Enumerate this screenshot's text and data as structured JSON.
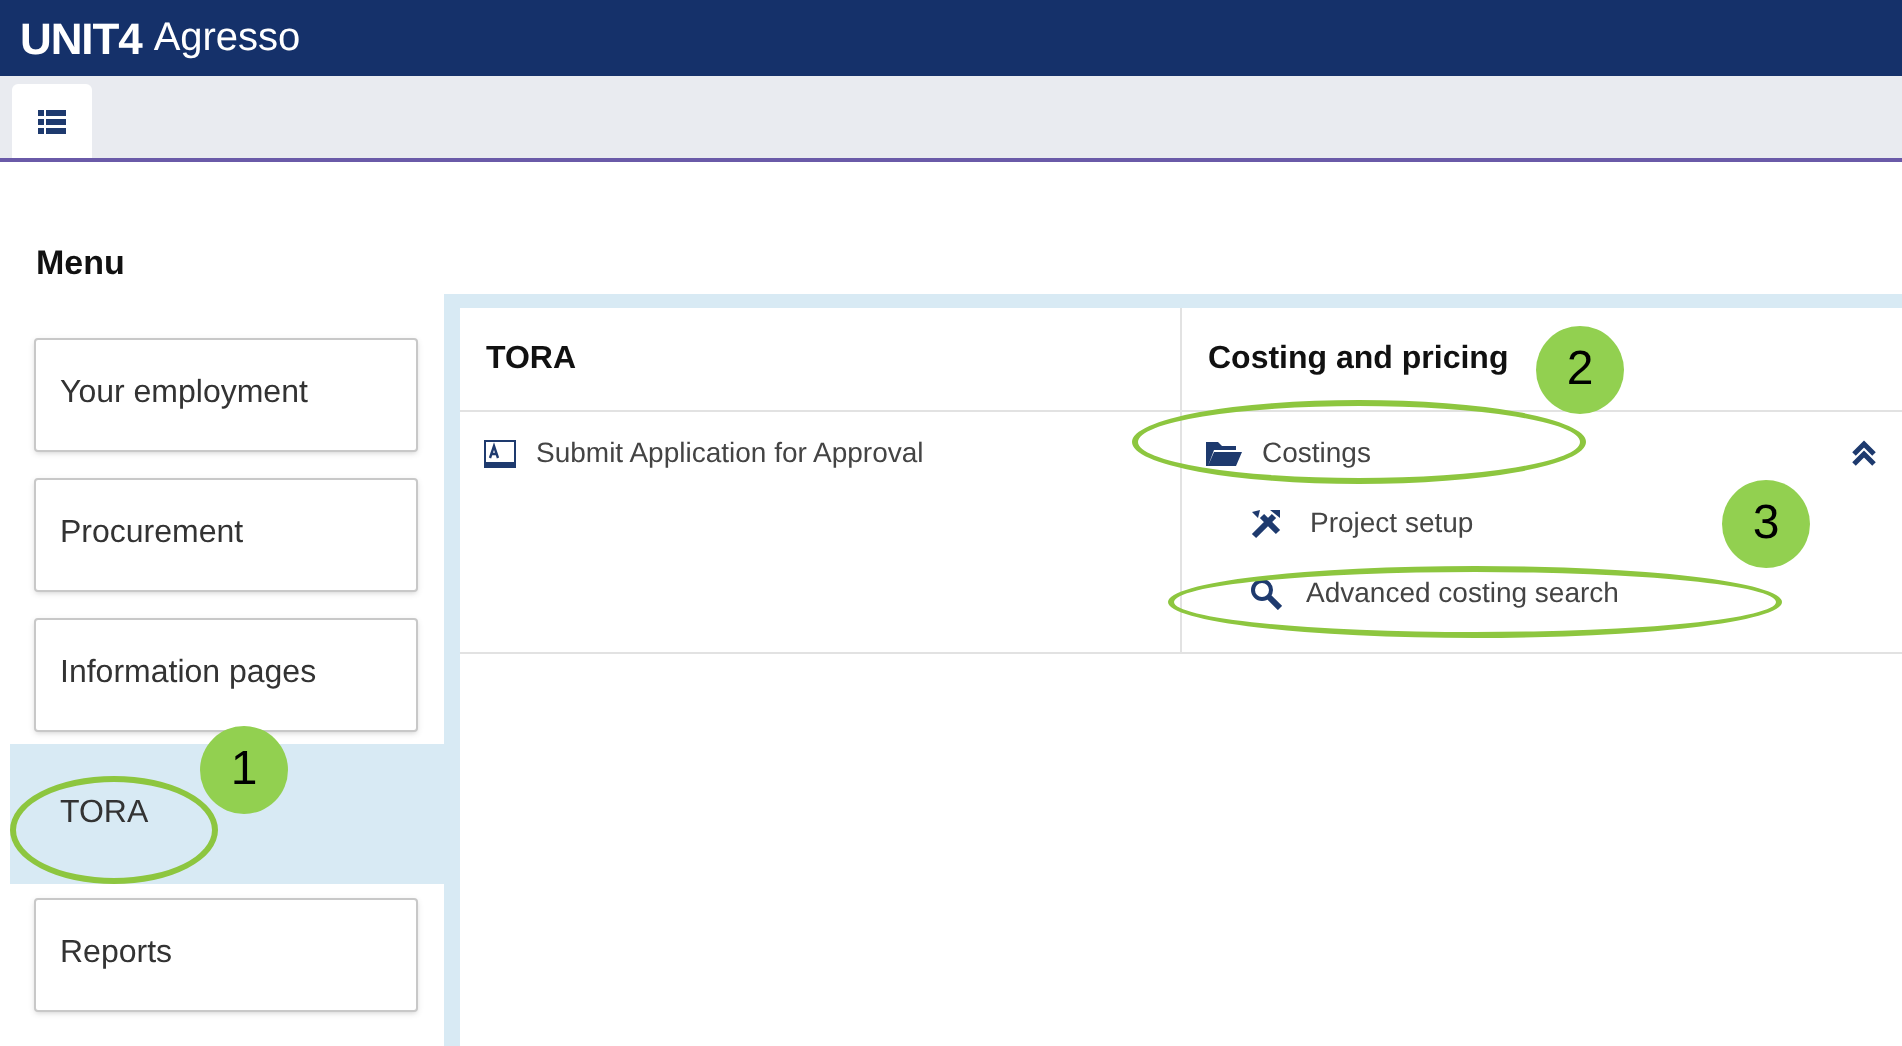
{
  "app": {
    "brand": "UNIT4",
    "product": "Agresso"
  },
  "tabs": [
    {
      "kind": "menu",
      "selected": true
    }
  ],
  "menu": {
    "title": "Menu",
    "items": [
      {
        "label": "Your employment",
        "selected": false
      },
      {
        "label": "Procurement",
        "selected": false
      },
      {
        "label": "Information pages",
        "selected": false
      },
      {
        "label": "TORA",
        "selected": true
      },
      {
        "label": "Reports",
        "selected": false
      }
    ]
  },
  "panel": {
    "columns": [
      {
        "title": "TORA",
        "items": [
          {
            "label": "Submit Application for Approval",
            "kind": "form"
          }
        ]
      },
      {
        "title": "Costing and pricing",
        "items": [
          {
            "label": "Costings",
            "kind": "folder",
            "expanded": true,
            "children": [
              {
                "label": "Project setup",
                "kind": "tools"
              },
              {
                "label": "Advanced costing search",
                "kind": "search"
              }
            ]
          }
        ]
      }
    ]
  },
  "annotations": [
    {
      "label": "1"
    },
    {
      "label": "2"
    },
    {
      "label": "3"
    }
  ]
}
